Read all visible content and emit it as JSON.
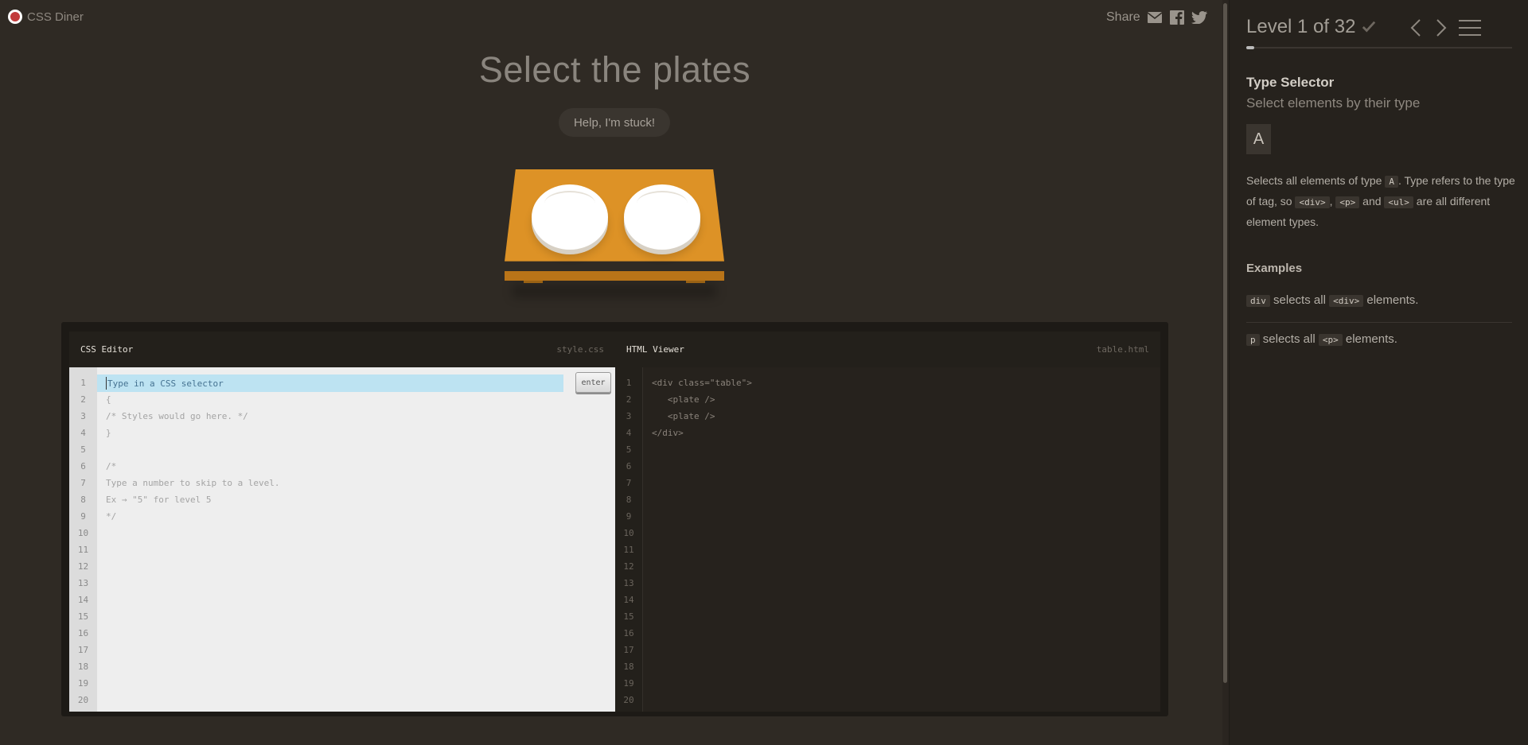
{
  "header": {
    "logo_text": "CSS Diner",
    "share_label": "Share",
    "share_icons": [
      "mail-icon",
      "facebook-icon",
      "twitter-icon"
    ]
  },
  "level": {
    "instruction": "Select the plates",
    "help_label": "Help, I'm stuck!"
  },
  "editor": {
    "css": {
      "title": "CSS Editor",
      "file": "style.css",
      "placeholder": "Type in a CSS selector",
      "enter_label": "enter",
      "lines": [
        "",
        "{",
        "/* Styles would go here. */",
        "}",
        "",
        "/*",
        "Type a number to skip to a level.",
        "Ex → \"5\" for level 5",
        "*/",
        "",
        "",
        "",
        "",
        "",
        "",
        "",
        "",
        "",
        "",
        ""
      ]
    },
    "html": {
      "title": "HTML Viewer",
      "file": "table.html",
      "lines": [
        "<div class=\"table\">",
        "   <plate />",
        "   <plate />",
        "</div>",
        "",
        "",
        "",
        "",
        "",
        "",
        "",
        "",
        "",
        "",
        "",
        "",
        "",
        "",
        "",
        ""
      ]
    },
    "line_numbers": [
      "1",
      "2",
      "3",
      "4",
      "5",
      "6",
      "7",
      "8",
      "9",
      "10",
      "11",
      "12",
      "13",
      "14",
      "15",
      "16",
      "17",
      "18",
      "19",
      "20"
    ]
  },
  "sidebar": {
    "level_label": "Level 1 of 32",
    "progress": 0.03,
    "selector_name": "Type Selector",
    "selector_subtitle": "Select elements by their type",
    "syntax": "A",
    "desc_1": "Selects all elements of type ",
    "desc_tag_a": "A",
    "desc_2": ". Type refers to the type of tag, so ",
    "desc_tag_div": "<div>",
    "desc_3": ", ",
    "desc_tag_p": "<p>",
    "desc_4": " and ",
    "desc_tag_ul": "<ul>",
    "desc_5": " are all different element types.",
    "examples_title": "Examples",
    "examples": [
      {
        "code": "div",
        "mid": " selects all ",
        "tag": "<div>",
        "end": " elements."
      },
      {
        "code": "p",
        "mid": " selects all ",
        "tag": "<p>",
        "end": " elements."
      }
    ]
  },
  "colors": {
    "background": "#2f2a24",
    "sidebar": "#26221d",
    "table": "#dd9226",
    "input_highlight": "#bde3f2"
  }
}
